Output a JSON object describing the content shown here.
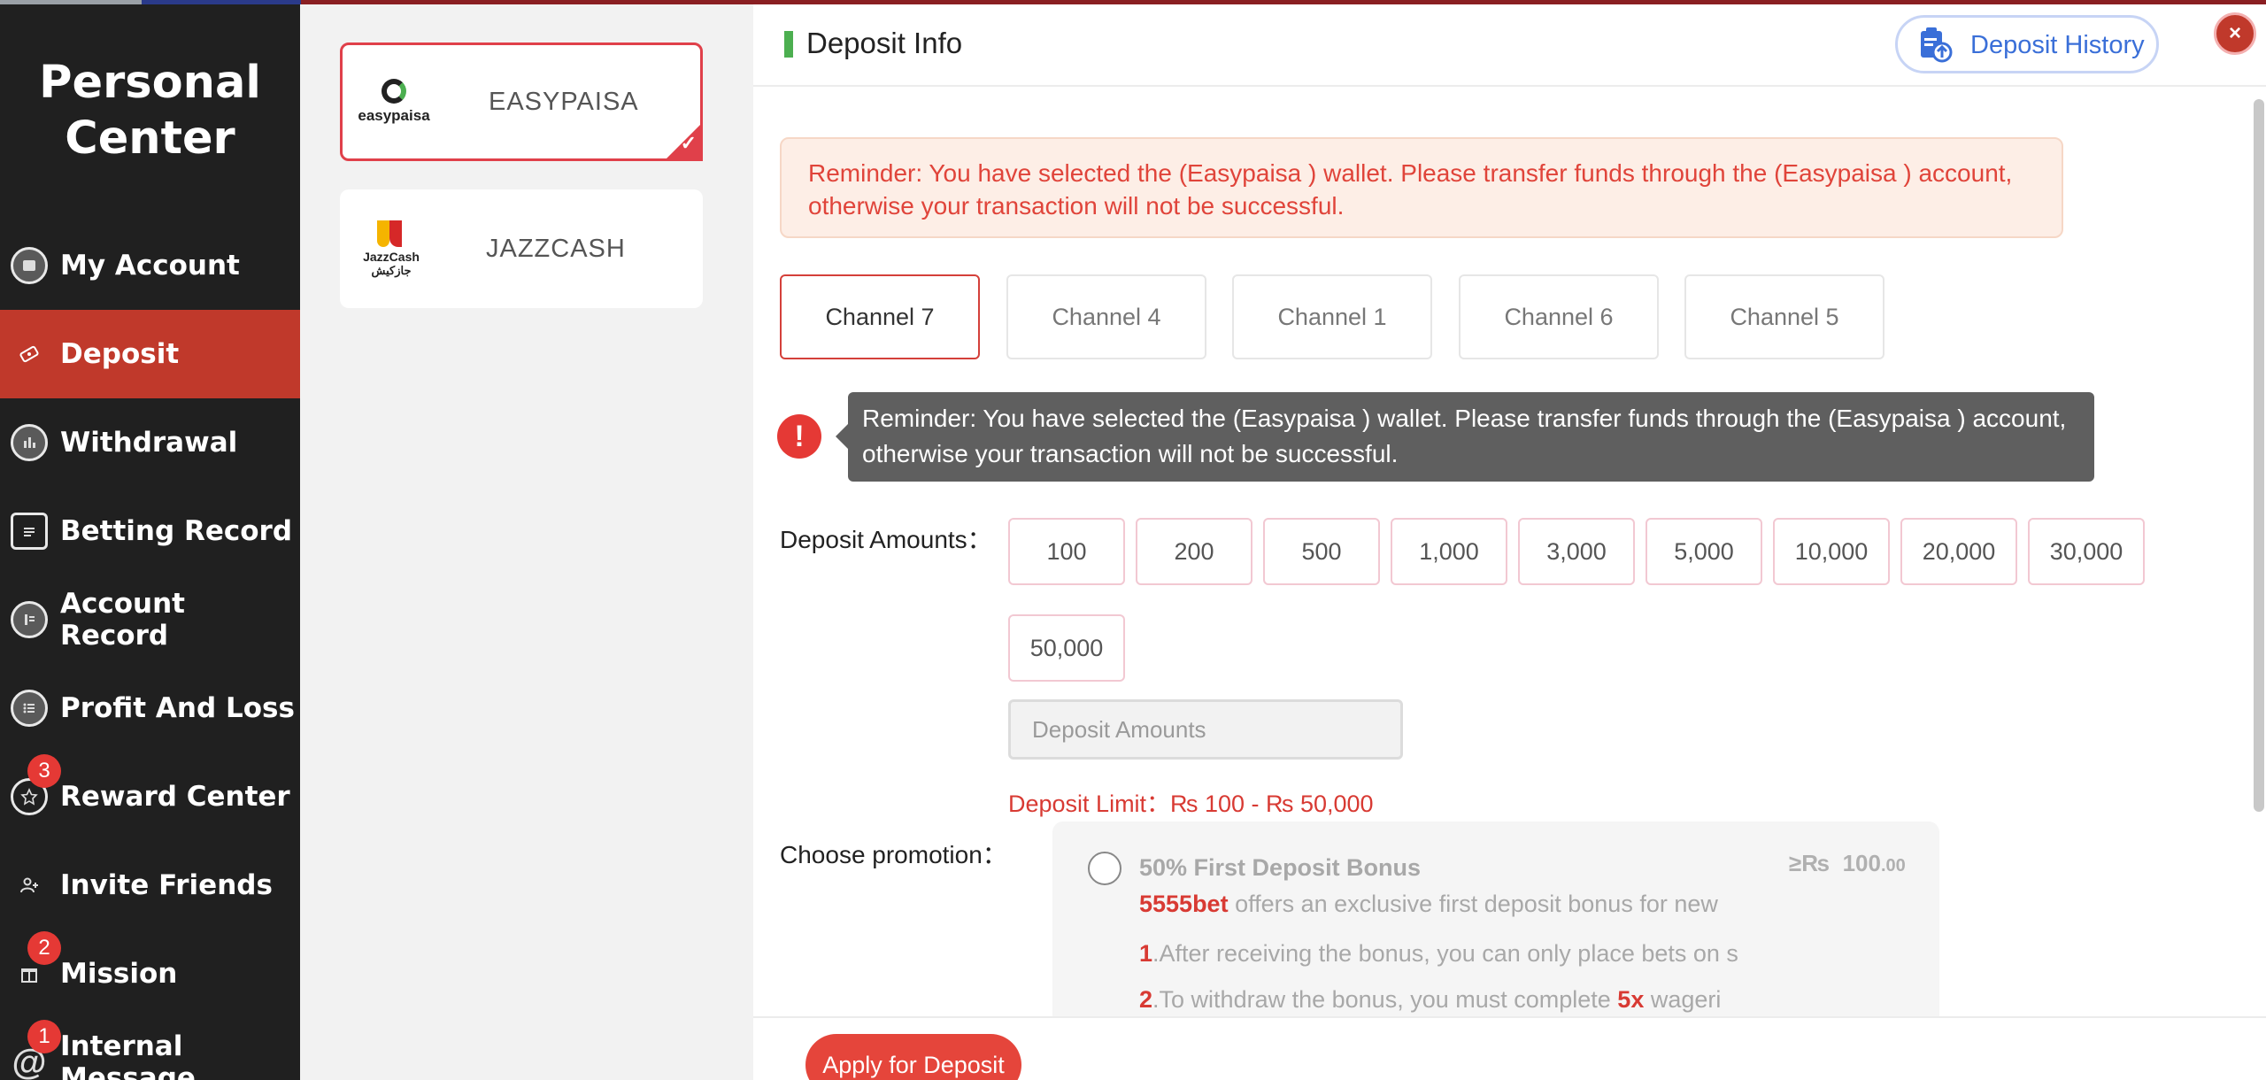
{
  "sidebar": {
    "title_line1": "Personal",
    "title_line2": "Center",
    "items": [
      {
        "label": "My Account",
        "badge": ""
      },
      {
        "label": "Deposit",
        "badge": ""
      },
      {
        "label": "Withdrawal",
        "badge": ""
      },
      {
        "label": "Betting Record",
        "badge": ""
      },
      {
        "label": "Account Record",
        "badge": ""
      },
      {
        "label": "Profit And Loss",
        "badge": ""
      },
      {
        "label": "Reward Center",
        "badge": "3"
      },
      {
        "label": "Invite Friends",
        "badge": ""
      },
      {
        "label": "Mission",
        "badge": "2"
      },
      {
        "label": "Internal Message",
        "badge": "1"
      }
    ],
    "active_item": "Deposit"
  },
  "wallets": [
    {
      "name": "EASYPAISA",
      "logo_text": "easypaisa",
      "selected": true
    },
    {
      "name": "JAZZCASH",
      "logo_text": "JazzCash",
      "logo_subtext": "جازکیش",
      "selected": false
    }
  ],
  "header": {
    "title": "Deposit Info",
    "history_label": "Deposit History",
    "close_label": "×"
  },
  "reminder": "Reminder: You have selected the (Easypaisa ) wallet. Please transfer funds through the (Easypaisa ) account, otherwise your transaction will not be successful.",
  "channels": [
    "Channel 7",
    "Channel 4",
    "Channel 1",
    "Channel 6",
    "Channel 5"
  ],
  "active_channel": "Channel 7",
  "tooltip": {
    "icon": "!",
    "text": "Reminder: You have selected the (Easypaisa ) wallet. Please transfer funds through the (Easypaisa ) account, otherwise your transaction will not be successful."
  },
  "deposit": {
    "amounts_label": "Deposit Amounts：",
    "amounts": [
      "100",
      "200",
      "500",
      "1,000",
      "3,000",
      "5,000",
      "10,000",
      "20,000",
      "30,000",
      "50,000"
    ],
    "input_placeholder": "Deposit Amounts",
    "limit_text": "Deposit Limit：₨ 100 - ₨ 50,000"
  },
  "promotion": {
    "label": "Choose promotion：",
    "title": "50% First Deposit Bonus",
    "min_prefix": "≥₨",
    "min_value": "100",
    "min_decimals": ".00",
    "brand": "5555bet",
    "desc_rest": " offers an exclusive first deposit bonus for new",
    "line1_num": "1",
    "line1_text": ".After receiving the bonus, you can only place bets on s",
    "line2_num": "2",
    "line2_text": ".To withdraw the bonus, you must complete ",
    "line2_mult": "5x",
    "line2_tail": " wageri"
  },
  "footer": {
    "apply_label": "Apply for Deposit"
  },
  "colors": {
    "accent_red": "#c0392b",
    "sidebar_bg": "#202020",
    "green_bar": "#4caf50",
    "history_blue": "#3a6fd8"
  }
}
